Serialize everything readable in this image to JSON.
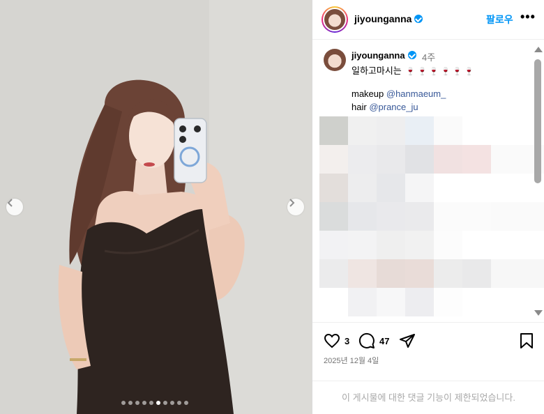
{
  "post": {
    "username": "jiyounganna",
    "follow_label": "팔로우",
    "more_label": "•••",
    "carousel": {
      "total": 10,
      "active_index": 5
    }
  },
  "caption": {
    "username": "jiyounganna",
    "time_ago": "4주",
    "line1": "일하고마시는",
    "wine_emoji": "🍷 🍷 🍷 🍷 🍷 🍷",
    "makeup_label": "makeup",
    "makeup_mention": "@hanmaeum_",
    "hair_label": "hair",
    "hair_mention": "@prance_ju"
  },
  "actions": {
    "like_count": "3",
    "comment_count": "47",
    "date": "2025년 12월 4일",
    "comments_restricted": "이 게시물에 대한 댓글 기능이 제한되었습니다."
  },
  "colors": {
    "accent": "#0095f6",
    "mention": "#385898",
    "muted": "#737373"
  },
  "icons": [
    "verified-badge-icon",
    "heart-icon",
    "comment-icon",
    "share-icon",
    "bookmark-icon",
    "chevron-left-icon",
    "chevron-right-icon"
  ]
}
